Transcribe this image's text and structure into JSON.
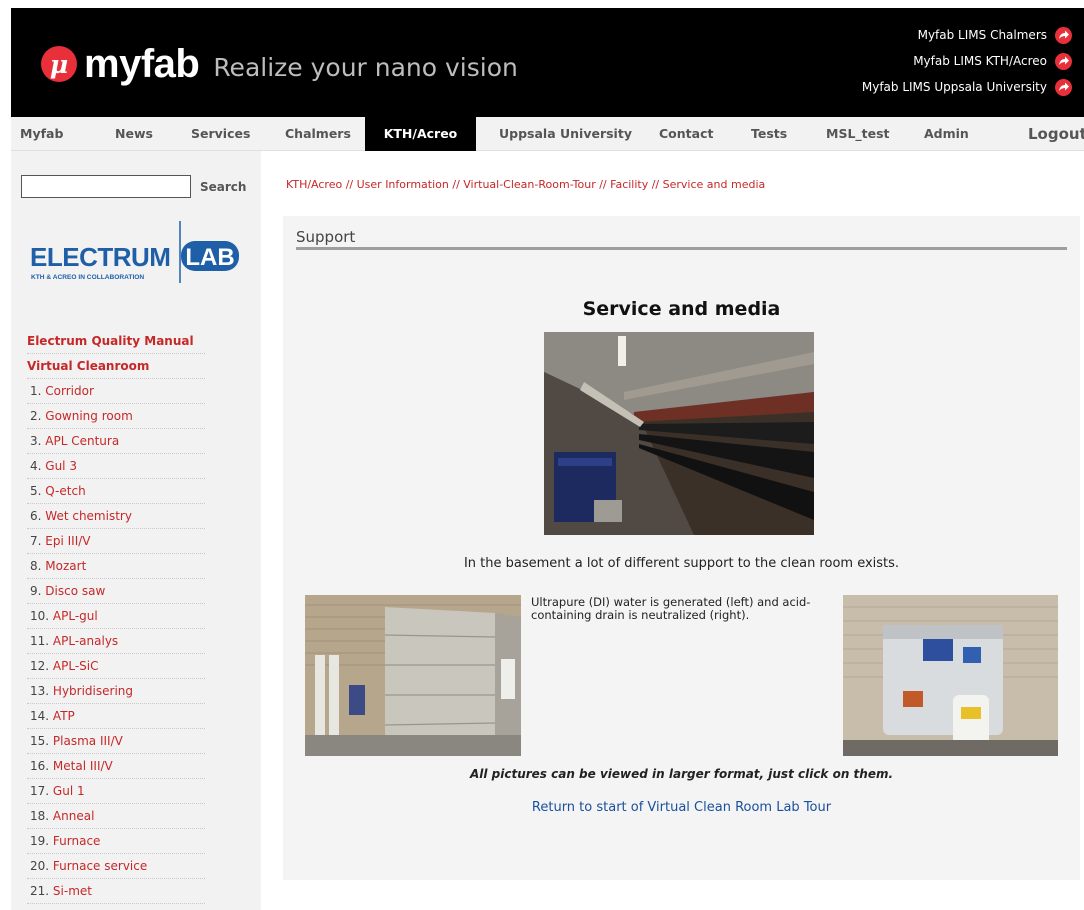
{
  "header": {
    "logo_glyph": "μ",
    "logo_text": "myfab",
    "tagline": "Realize your nano vision",
    "lims_links": [
      {
        "label": "Myfab LIMS Chalmers",
        "icon": "external-arrow-icon"
      },
      {
        "label": "Myfab LIMS KTH/Acreo",
        "icon": "external-arrow-icon"
      },
      {
        "label": "Myfab LIMS Uppsala University",
        "icon": "external-arrow-icon"
      }
    ],
    "accent_color": "#e8303a"
  },
  "nav": {
    "items": [
      {
        "label": "Myfab"
      },
      {
        "label": "News"
      },
      {
        "label": "Services"
      },
      {
        "label": "Chalmers"
      },
      {
        "label": "KTH/Acreo",
        "active": true
      },
      {
        "label": "Uppsala University"
      },
      {
        "label": "Contact"
      },
      {
        "label": "Tests"
      },
      {
        "label": "MSL_test"
      },
      {
        "label": "Admin"
      },
      {
        "label": "Logout"
      }
    ]
  },
  "sidebar": {
    "search_label": "Search",
    "search_value": "",
    "logo_left": "ELECTRUM",
    "logo_right": "LAB",
    "logo_sub": "KTH & ACREO IN COLLABORATION",
    "links": [
      {
        "label": "Electrum Quality Manual",
        "bold": true
      },
      {
        "label": "Virtual Cleanroom",
        "bold": true
      },
      {
        "num": "1.",
        "label": "Corridor"
      },
      {
        "num": "2.",
        "label": "Gowning room"
      },
      {
        "num": "3.",
        "label": "APL Centura"
      },
      {
        "num": "4.",
        "label": "Gul 3"
      },
      {
        "num": "5.",
        "label": "Q-etch"
      },
      {
        "num": "6.",
        "label": "Wet chemistry"
      },
      {
        "num": "7.",
        "label": "Epi III/V"
      },
      {
        "num": "8.",
        "label": "Mozart"
      },
      {
        "num": "9.",
        "label": "Disco saw"
      },
      {
        "num": "10.",
        "label": "APL-gul"
      },
      {
        "num": "11.",
        "label": "APL-analys"
      },
      {
        "num": "12.",
        "label": "APL-SiC"
      },
      {
        "num": "13.",
        "label": "Hybridisering"
      },
      {
        "num": "14.",
        "label": "ATP"
      },
      {
        "num": "15.",
        "label": "Plasma III/V"
      },
      {
        "num": "16.",
        "label": "Metal III/V"
      },
      {
        "num": "17.",
        "label": "Gul 1"
      },
      {
        "num": "18.",
        "label": "Anneal"
      },
      {
        "num": "19.",
        "label": "Furnace"
      },
      {
        "num": "20.",
        "label": "Furnace service"
      },
      {
        "num": "21.",
        "label": "Si-met"
      }
    ]
  },
  "main": {
    "breadcrumb": "KTH/Acreo // User Information // Virtual-Clean-Room-Tour // Facility // Service and media",
    "section_title": "Support",
    "heading": "Service and media",
    "intro": "In the basement a lot of different support to the clean room exists.",
    "ultrapure_text": "Ultrapure (DI) water is generated (left) and acid-containing drain is neutralized (right).",
    "note": "All pictures can be viewed in larger format, just click on them.",
    "return_link": "Return to start of Virtual Clean Room Lab Tour"
  }
}
